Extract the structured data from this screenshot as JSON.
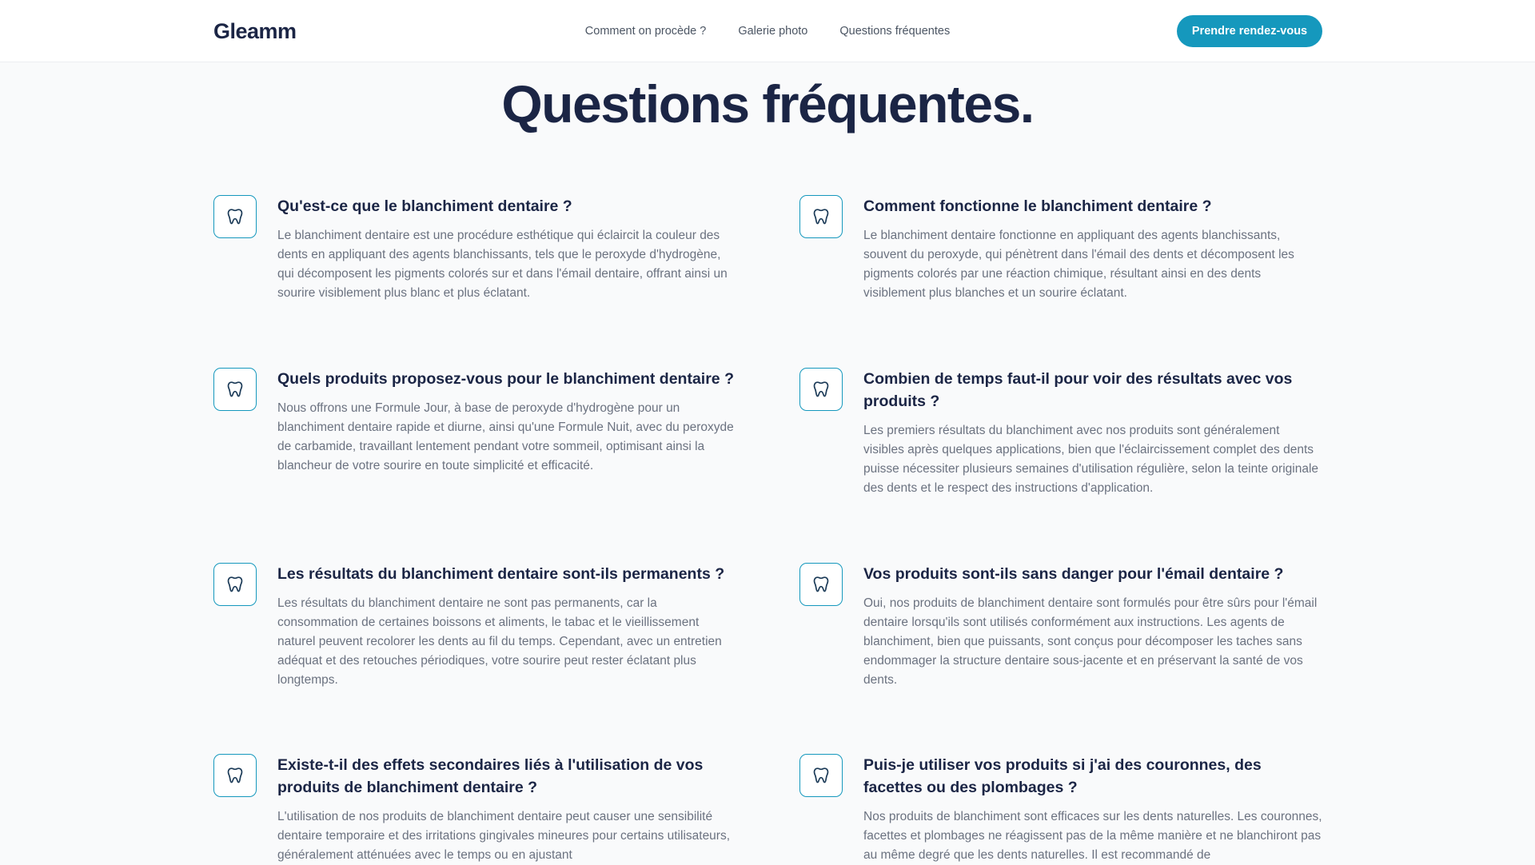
{
  "header": {
    "logo": "Gleamm",
    "nav": [
      "Comment on procède ?",
      "Galerie photo",
      "Questions fréquentes"
    ],
    "cta_label": "Prendre rendez-vous"
  },
  "colors": {
    "accent": "#1598bd",
    "heading": "#1b2545",
    "body_text": "#6b7280",
    "background": "#f9fafb"
  },
  "page_title": "Questions fréquentes.",
  "faq": [
    {
      "icon": "tooth-icon",
      "question": "Qu'est-ce que le blanchiment dentaire ?",
      "answer": "Le blanchiment dentaire est une procédure esthétique qui éclaircit la couleur des dents en appliquant des agents blanchissants, tels que le peroxyde d'hydrogène, qui décomposent les pigments colorés sur et dans l'émail dentaire, offrant ainsi un sourire visiblement plus blanc et plus éclatant."
    },
    {
      "icon": "tooth-icon",
      "question": "Comment fonctionne le blanchiment dentaire ?",
      "answer": "Le blanchiment dentaire fonctionne en appliquant des agents blanchissants, souvent du peroxyde, qui pénètrent dans l'émail des dents et décomposent les pigments colorés par une réaction chimique, résultant ainsi en des dents visiblement plus blanches et un sourire éclatant."
    },
    {
      "icon": "tooth-icon",
      "question": "Quels produits proposez-vous pour le blanchiment dentaire ?",
      "answer": "Nous offrons une Formule Jour, à base de peroxyde d'hydrogène pour un blanchiment dentaire rapide et diurne, ainsi qu'une Formule Nuit, avec du peroxyde de carbamide, travaillant lentement pendant votre sommeil, optimisant ainsi la blancheur de votre sourire en toute simplicité et efficacité."
    },
    {
      "icon": "tooth-icon",
      "question": "Combien de temps faut-il pour voir des résultats avec vos produits ?",
      "answer": "Les premiers résultats du blanchiment avec nos produits sont généralement visibles après quelques applications, bien que l'éclaircissement complet des dents puisse nécessiter plusieurs semaines d'utilisation régulière, selon la teinte originale des dents et le respect des instructions d'application."
    },
    {
      "icon": "tooth-icon",
      "question": "Les résultats du blanchiment dentaire sont-ils permanents ?",
      "answer": "Les résultats du blanchiment dentaire ne sont pas permanents, car la consommation de certaines boissons et aliments, le tabac et le vieillissement naturel peuvent recolorer les dents au fil du temps. Cependant, avec un entretien adéquat et des retouches périodiques, votre sourire peut rester éclatant plus longtemps."
    },
    {
      "icon": "tooth-icon",
      "question": "Vos produits sont-ils sans danger pour l'émail dentaire ?",
      "answer": "Oui, nos produits de blanchiment dentaire sont formulés pour être sûrs pour l'émail dentaire lorsqu'ils sont utilisés conformément aux instructions. Les agents de blanchiment, bien que puissants, sont conçus pour décomposer les taches sans endommager la structure dentaire sous-jacente et en préservant la santé de vos dents."
    },
    {
      "icon": "tooth-icon",
      "question": "Existe-t-il des effets secondaires liés à l'utilisation de vos produits de blanchiment dentaire ?",
      "answer": "L'utilisation de nos produits de blanchiment dentaire peut causer une sensibilité dentaire temporaire et des irritations gingivales mineures pour certains utilisateurs, généralement atténuées avec le temps ou en ajustant"
    },
    {
      "icon": "tooth-icon",
      "question": "Puis-je utiliser vos produits si j'ai des couronnes, des facettes ou des plombages ?",
      "answer": "Nos produits de blanchiment sont efficaces sur les dents naturelles. Les couronnes, facettes et plombages ne réagissent pas de la même manière et ne blanchiront pas au même degré que les dents naturelles. Il est recommandé de"
    }
  ]
}
